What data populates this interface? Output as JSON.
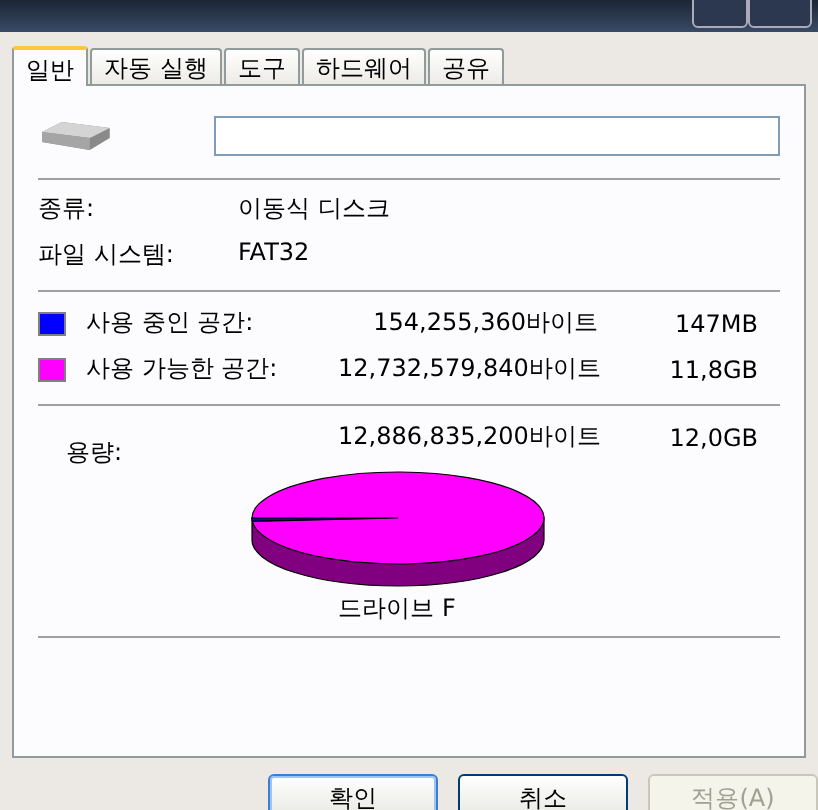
{
  "tabs": [
    {
      "label": "일반",
      "selected": true
    },
    {
      "label": "자동 실행",
      "selected": false
    },
    {
      "label": "도구",
      "selected": false
    },
    {
      "label": "하드웨어",
      "selected": false
    },
    {
      "label": "공유",
      "selected": false
    }
  ],
  "info": [
    {
      "label": "종류:",
      "value": "이동식 디스크"
    },
    {
      "label": "파일 시스템:",
      "value": "FAT32"
    }
  ],
  "space": [
    {
      "label": "사용 중인 공간:",
      "bytes": "154,255,360바이트",
      "size": "147MB",
      "color": "#0000ff"
    },
    {
      "label": "사용 가능한 공간:",
      "bytes": "12,732,579,840바이트",
      "size": "11,8GB",
      "color": "#ff00ff"
    }
  ],
  "capacity": {
    "label": "용량:",
    "bytes": "12,886,835,200바이트",
    "size": "12,0GB"
  },
  "drive_label": "드라이브 F",
  "buttons": [
    {
      "label": "확인",
      "default": true,
      "disabled": false
    },
    {
      "label": "취소",
      "default": false,
      "disabled": false
    },
    {
      "label": "적용(A)",
      "default": false,
      "disabled": true
    }
  ]
}
